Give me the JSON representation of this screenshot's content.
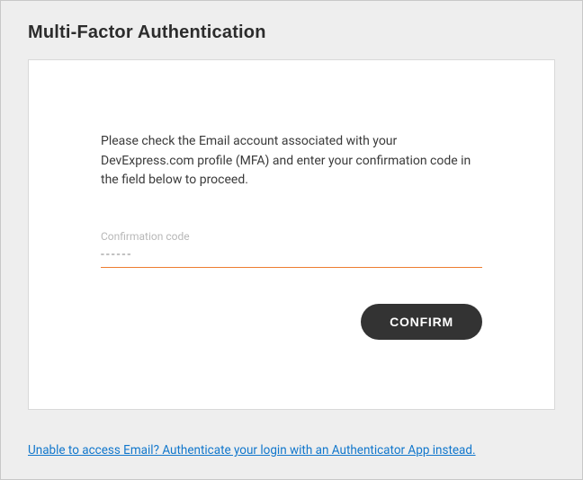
{
  "page": {
    "title": "Multi-Factor Authentication"
  },
  "card": {
    "instruction": "Please check the Email account associated with your DevExpress.com profile (MFA) and enter your confirmation code in the field below to proceed.",
    "field_label": "Confirmation code",
    "code_placeholder": "------",
    "confirm_label": "CONFIRM"
  },
  "alt_link": {
    "text": "Unable to access Email? Authenticate your login with an Authenticator App instead."
  }
}
